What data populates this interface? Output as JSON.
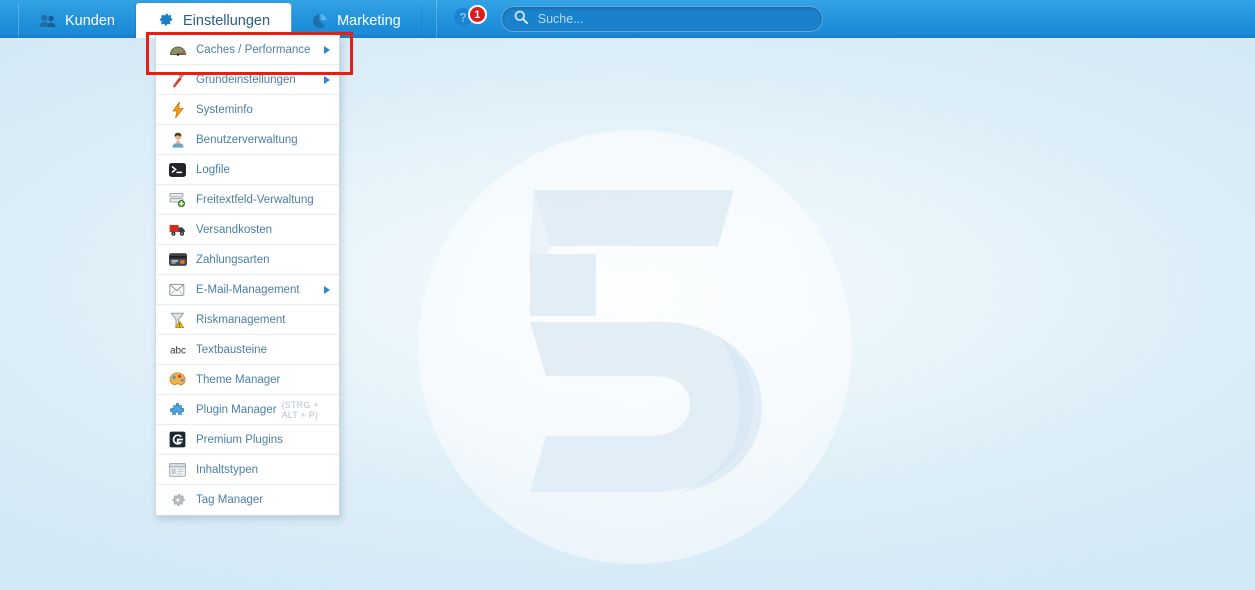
{
  "header": {
    "tabs": [
      {
        "label": "Kunden",
        "icon": "users-icon",
        "active": false
      },
      {
        "label": "Einstellungen",
        "icon": "gear-icon",
        "active": true
      },
      {
        "label": "Marketing",
        "icon": "pie-chart-icon",
        "active": false
      }
    ],
    "help": {
      "icon": "help-icon",
      "badge_count": "1"
    },
    "search": {
      "icon": "search-icon",
      "placeholder": "Suche...",
      "value": ""
    }
  },
  "menu": {
    "items": [
      {
        "label": "Caches / Performance",
        "icon": "gauge-icon",
        "submenu": true,
        "highlighted": true,
        "shortcut": ""
      },
      {
        "label": "Grundeinstellungen",
        "icon": "screwdriver-icon",
        "submenu": true,
        "highlighted": false,
        "shortcut": ""
      },
      {
        "label": "Systeminfo",
        "icon": "lightning-icon",
        "submenu": false,
        "highlighted": false,
        "shortcut": ""
      },
      {
        "label": "Benutzerverwaltung",
        "icon": "user-icon",
        "submenu": false,
        "highlighted": false,
        "shortcut": ""
      },
      {
        "label": "Logfile",
        "icon": "console-icon",
        "submenu": false,
        "highlighted": false,
        "shortcut": ""
      },
      {
        "label": "Freitextfeld-Verwaltung",
        "icon": "form-fields-icon",
        "submenu": false,
        "highlighted": false,
        "shortcut": ""
      },
      {
        "label": "Versandkosten",
        "icon": "truck-icon",
        "submenu": false,
        "highlighted": false,
        "shortcut": ""
      },
      {
        "label": "Zahlungsarten",
        "icon": "credit-card-icon",
        "submenu": false,
        "highlighted": false,
        "shortcut": ""
      },
      {
        "label": "E-Mail-Management",
        "icon": "envelope-icon",
        "submenu": true,
        "highlighted": false,
        "shortcut": ""
      },
      {
        "label": "Riskmanagement",
        "icon": "funnel-warning-icon",
        "submenu": false,
        "highlighted": false,
        "shortcut": ""
      },
      {
        "label": "Textbausteine",
        "icon": "abc-icon",
        "submenu": false,
        "highlighted": false,
        "shortcut": ""
      },
      {
        "label": "Theme Manager",
        "icon": "palette-icon",
        "submenu": false,
        "highlighted": false,
        "shortcut": ""
      },
      {
        "label": "Plugin Manager",
        "icon": "puzzle-icon",
        "submenu": false,
        "highlighted": false,
        "shortcut": "(STRG + ALT + P)"
      },
      {
        "label": "Premium Plugins",
        "icon": "premium-g-icon",
        "submenu": false,
        "highlighted": false,
        "shortcut": ""
      },
      {
        "label": "Inhaltstypen",
        "icon": "content-type-icon",
        "submenu": false,
        "highlighted": false,
        "shortcut": ""
      },
      {
        "label": "Tag Manager",
        "icon": "gear-grey-icon",
        "submenu": false,
        "highlighted": false,
        "shortcut": ""
      }
    ]
  },
  "background": {
    "watermark": "shopware-5-logo"
  },
  "annotation": {
    "type": "red-rectangle",
    "target": "Caches / Performance"
  },
  "colors": {
    "header_blue": "#2494dd",
    "header_border": "#1c7ec4",
    "menu_text": "#4a7fa5",
    "annotation_red": "#ee1b11",
    "badge_red": "#e01b1b",
    "desktop_blue": "#dceef8"
  }
}
